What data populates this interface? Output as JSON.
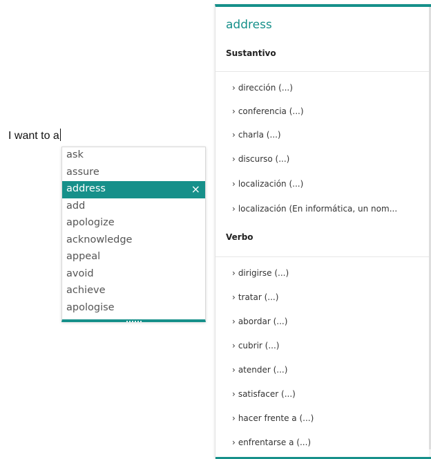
{
  "editor": {
    "typed_text": "I want to a"
  },
  "suggestions": {
    "items": [
      "ask",
      "assure",
      "address",
      "add",
      "apologize",
      "acknowledge",
      "appeal",
      "avoid",
      "achieve",
      "apologise"
    ],
    "selected_index": 2,
    "close_symbol": "×"
  },
  "panel": {
    "word": "address",
    "sections": [
      {
        "pos": "Sustantivo",
        "translations": [
          "dirección (...)",
          "conferencia (...)",
          "charla (...)",
          "discurso (...)",
          "localización (...)",
          "localización (En informática, un nom..."
        ]
      },
      {
        "pos": "Verbo",
        "translations": [
          "dirigirse (...)",
          "tratar (...)",
          "abordar (...)",
          "cubrir (...)",
          "atender (...)",
          "satisfacer (...)",
          "hacer frente a (...)",
          "enfrentarse a (...)"
        ]
      }
    ],
    "chevron": "›"
  },
  "colors": {
    "accent": "#16908a"
  }
}
